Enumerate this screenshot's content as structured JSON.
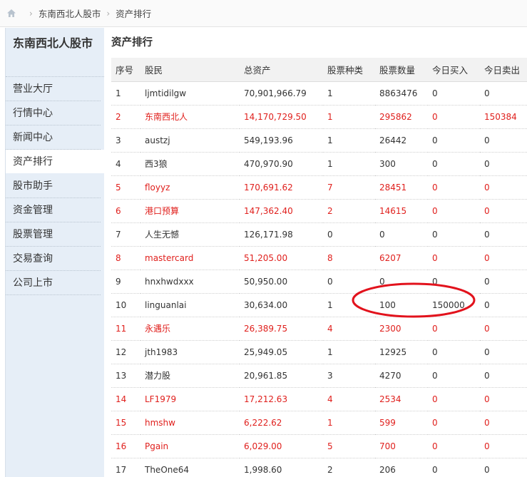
{
  "breadcrumb": {
    "home_icon": "home-icon",
    "items": [
      "东南西北人股市",
      "资产排行"
    ]
  },
  "sidebar": {
    "title": "东南西北人股市",
    "items": [
      {
        "label": "营业大厅",
        "active": false
      },
      {
        "label": "行情中心",
        "active": false
      },
      {
        "label": "新闻中心",
        "active": false
      },
      {
        "label": "资产排行",
        "active": true
      },
      {
        "label": "股市助手",
        "active": false
      },
      {
        "label": "资金管理",
        "active": false
      },
      {
        "label": "股票管理",
        "active": false
      },
      {
        "label": "交易查询",
        "active": false
      },
      {
        "label": "公司上市",
        "active": false
      }
    ]
  },
  "main": {
    "title": "资产排行",
    "columns": [
      "序号",
      "股民",
      "总资产",
      "股票种类",
      "股票数量",
      "今日买入",
      "今日卖出"
    ],
    "rows": [
      {
        "rank": "1",
        "user": "ljmtidilgw",
        "assets": "70,901,966.79",
        "kinds": "1",
        "shares": "8863476",
        "buy": "0",
        "sell": "0",
        "highlight": false
      },
      {
        "rank": "2",
        "user": "东南西北人",
        "assets": "14,170,729.50",
        "kinds": "1",
        "shares": "295862",
        "buy": "0",
        "sell": "150384",
        "highlight": true
      },
      {
        "rank": "3",
        "user": "austzj",
        "assets": "549,193.96",
        "kinds": "1",
        "shares": "26442",
        "buy": "0",
        "sell": "0",
        "highlight": false
      },
      {
        "rank": "4",
        "user": "西3狼",
        "assets": "470,970.90",
        "kinds": "1",
        "shares": "300",
        "buy": "0",
        "sell": "0",
        "highlight": false
      },
      {
        "rank": "5",
        "user": "floyyz",
        "assets": "170,691.62",
        "kinds": "7",
        "shares": "28451",
        "buy": "0",
        "sell": "0",
        "highlight": true
      },
      {
        "rank": "6",
        "user": "港口预算",
        "assets": "147,362.40",
        "kinds": "2",
        "shares": "14615",
        "buy": "0",
        "sell": "0",
        "highlight": true
      },
      {
        "rank": "7",
        "user": "人生无憾",
        "assets": "126,171.98",
        "kinds": "0",
        "shares": "0",
        "buy": "0",
        "sell": "0",
        "highlight": false
      },
      {
        "rank": "8",
        "user": "mastercard",
        "assets": "51,205.00",
        "kinds": "8",
        "shares": "6207",
        "buy": "0",
        "sell": "0",
        "highlight": true
      },
      {
        "rank": "9",
        "user": "hnxhwdxxx",
        "assets": "50,950.00",
        "kinds": "0",
        "shares": "0",
        "buy": "0",
        "sell": "0",
        "highlight": false
      },
      {
        "rank": "10",
        "user": "linguanlai",
        "assets": "30,634.00",
        "kinds": "1",
        "shares": "100",
        "buy": "150000",
        "sell": "0",
        "highlight": false
      },
      {
        "rank": "11",
        "user": "永遇乐",
        "assets": "26,389.75",
        "kinds": "4",
        "shares": "2300",
        "buy": "0",
        "sell": "0",
        "highlight": true
      },
      {
        "rank": "12",
        "user": "jth1983",
        "assets": "25,949.05",
        "kinds": "1",
        "shares": "12925",
        "buy": "0",
        "sell": "0",
        "highlight": false
      },
      {
        "rank": "13",
        "user": "潜力股",
        "assets": "20,961.85",
        "kinds": "3",
        "shares": "4270",
        "buy": "0",
        "sell": "0",
        "highlight": false
      },
      {
        "rank": "14",
        "user": "LF1979",
        "assets": "17,212.63",
        "kinds": "4",
        "shares": "2534",
        "buy": "0",
        "sell": "0",
        "highlight": true
      },
      {
        "rank": "15",
        "user": "hmshw",
        "assets": "6,222.62",
        "kinds": "1",
        "shares": "599",
        "buy": "0",
        "sell": "0",
        "highlight": true
      },
      {
        "rank": "16",
        "user": "Pgain",
        "assets": "6,029.00",
        "kinds": "5",
        "shares": "700",
        "buy": "0",
        "sell": "0",
        "highlight": true
      },
      {
        "rank": "17",
        "user": "TheOne64",
        "assets": "1,998.60",
        "kinds": "2",
        "shares": "206",
        "buy": "0",
        "sell": "0",
        "highlight": false
      }
    ]
  },
  "annotation": {
    "shape": "ellipse",
    "color": "#e2121c"
  },
  "colors": {
    "highlight_text": "#e0201d",
    "sidebar_bg": "#e6eef7"
  }
}
